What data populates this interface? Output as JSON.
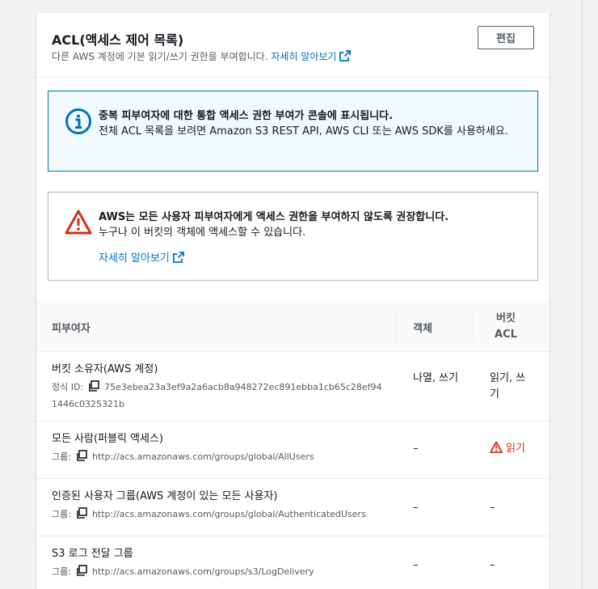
{
  "panel": {
    "title": "ACL(액세스 제어 목록)",
    "subtitle": "다른 AWS 계정에 기본 읽기/쓰기 권한을 부여합니다.",
    "subtitle_link": "자세히 알아보기",
    "edit_label": "편집"
  },
  "info_alert": {
    "title": "중복 피부여자에 대한 통합 액세스 권한 부여가 콘솔에 표시됩니다.",
    "body": "전체 ACL 목록을 보려면 Amazon S3 REST API, AWS CLI 또는 AWS SDK를 사용하세요."
  },
  "warning_alert": {
    "title": "AWS는 모든 사용자 피부여자에게 액세스 권한을 부여하지 않도록 권장합니다.",
    "body": "누구나 이 버킷의 객체에 액세스할 수 있습니다.",
    "link": "자세히 알아보기"
  },
  "table": {
    "headers": {
      "grantee": "피부여자",
      "objects": "객체",
      "bucket_acl": "버킷 ACL"
    },
    "rows": [
      {
        "title": "버킷 소유자(AWS 계정)",
        "meta_label": "정식 ID:",
        "meta_value": "75e3ebea23a3ef9a2a6acb8a948272ec891ebba1cb65c28ef941446c0325321b",
        "objects": "나열, 쓰기",
        "bucket_acl": "읽기, 쓰기"
      },
      {
        "title": "모든 사람(퍼블릭 액세스)",
        "meta_label": "그룹:",
        "meta_value": "http://acs.amazonaws.com/groups/global/AllUsers",
        "objects": "–",
        "bucket_acl": "읽기"
      },
      {
        "title": "인증된 사용자 그룹(AWS 계정이 있는 모든 사용자)",
        "meta_label": "그룹:",
        "meta_value": "http://acs.amazonaws.com/groups/global/AuthenticatedUsers",
        "objects": "–",
        "bucket_acl": "–"
      },
      {
        "title": "S3 로그 전달 그룹",
        "meta_label": "그룹:",
        "meta_value": "http://acs.amazonaws.com/groups/s3/LogDelivery",
        "objects": "–",
        "bucket_acl": "–"
      }
    ]
  },
  "colors": {
    "link": "#0073bb",
    "info_border": "#0073bb",
    "warning": "#d13212"
  }
}
